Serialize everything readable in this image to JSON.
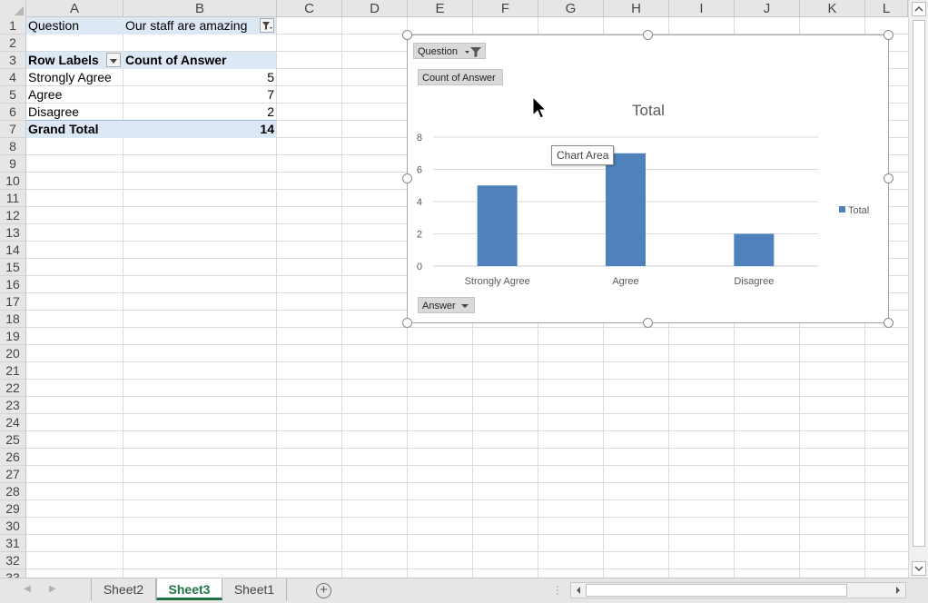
{
  "columns": [
    "A",
    "B",
    "C",
    "D",
    "E",
    "F",
    "G",
    "H",
    "I",
    "J",
    "K",
    "L"
  ],
  "rows": [
    "1",
    "2",
    "3",
    "4",
    "5",
    "6",
    "7",
    "8",
    "9",
    "10",
    "11",
    "12",
    "13",
    "14",
    "15",
    "16",
    "17",
    "18",
    "19",
    "20",
    "21",
    "22",
    "23",
    "24",
    "25",
    "26",
    "27",
    "28",
    "29",
    "30",
    "31",
    "32",
    "33"
  ],
  "pivot": {
    "filter_label": "Question",
    "filter_value": "Our staff are amazing",
    "row_labels_header": "Row Labels",
    "count_header": "Count of Answer",
    "items": [
      {
        "label": "Strongly Agree",
        "count": "5"
      },
      {
        "label": "Agree",
        "count": "7"
      },
      {
        "label": "Disagree",
        "count": "2"
      }
    ],
    "grand_total_label": "Grand Total",
    "grand_total_value": "14"
  },
  "chart": {
    "question_button": "Question",
    "count_button": "Count of Answer",
    "answer_button": "Answer",
    "tooltip": "Chart Area",
    "bar_color": "#4f81bd"
  },
  "chart_data": {
    "type": "bar",
    "title": "Total",
    "categories": [
      "Strongly Agree",
      "Agree",
      "Disagree"
    ],
    "series": [
      {
        "name": "Total",
        "values": [
          5,
          7,
          2
        ]
      }
    ],
    "yticks": [
      "0",
      "2",
      "4",
      "6",
      "8"
    ],
    "ylim": [
      0,
      8
    ],
    "grid": true,
    "legend": "right"
  },
  "sheets": {
    "tabs": [
      "Sheet2",
      "Sheet3",
      "Sheet1"
    ],
    "active": "Sheet3",
    "add_icon": "plus-circle-icon"
  }
}
